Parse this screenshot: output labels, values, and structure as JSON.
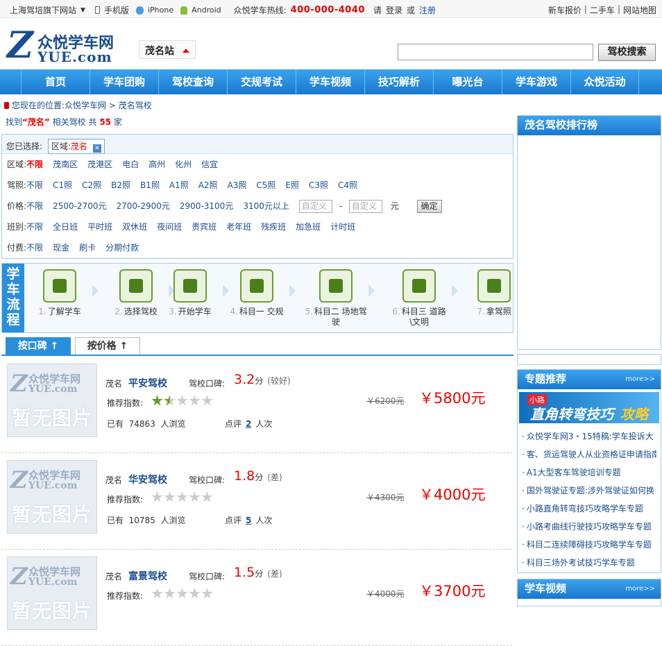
{
  "topbar": {
    "site_brand": "上海驾培旗下网站",
    "mobile": "手机版",
    "iphone": "iPhone",
    "android": "Android",
    "hotline_label": "众悦学车热线:",
    "hotline": "400-000-4040",
    "please": "请",
    "login": "登录",
    "or": "或",
    "register": "注册",
    "links": [
      "新车报价",
      "二手车",
      "网站地图"
    ],
    "sep": "|"
  },
  "header": {
    "logo_z": "Z",
    "logo_cn": "众悦学车网",
    "logo_en": "YUE.com",
    "city": "茂名站",
    "search_placeholder": "",
    "search_button": "驾校搜索"
  },
  "nav": [
    "首页",
    "学车团购",
    "驾校查询",
    "交规考试",
    "学车视频",
    "技巧解析",
    "曝光台",
    "学车游戏",
    "众悦活动"
  ],
  "breadcrumb": {
    "prefix": "您现在的位置:",
    "home": "众悦学车网",
    "arrow": ">",
    "current": "茂名驾校"
  },
  "found": {
    "pre": "找到",
    "keyword": "“茂名”",
    "mid": "相关驾校",
    "gong": "共",
    "count": "55",
    "unit": "家"
  },
  "filter": {
    "selected_label": "您已选择:",
    "selected_key": "区域:",
    "selected_val": "茂名",
    "rows": [
      {
        "label": "区域:",
        "options": [
          "不限",
          "茂南区",
          "茂港区",
          "电白",
          "高州",
          "化州",
          "信宜"
        ],
        "active": 0
      },
      {
        "label": "驾照:",
        "options": [
          "不限",
          "C1照",
          "C2照",
          "B2照",
          "B1照",
          "A1照",
          "A2照",
          "A3照",
          "C5照",
          "E照",
          "C3照",
          "C4照"
        ],
        "active": -1
      },
      {
        "label": "价格:",
        "options": [
          "不限",
          "2500-2700元",
          "2700-2900元",
          "2900-3100元",
          "3100元以上"
        ],
        "active": -1
      },
      {
        "label": "班别:",
        "options": [
          "不限",
          "全日班",
          "平时班",
          "双休班",
          "夜间班",
          "贵宾班",
          "老年班",
          "残疾班",
          "加急班",
          "计时班"
        ],
        "active": -1
      },
      {
        "label": "付费:",
        "options": [
          "不限",
          "现金",
          "刷卡",
          "分期付款"
        ],
        "active": -1
      }
    ],
    "custom1": "自定义",
    "dash": "-",
    "custom2": "自定义",
    "yuan": "元",
    "ok": "确定"
  },
  "process": {
    "title": "学车流程",
    "steps": [
      {
        "num": "1.",
        "text": "了解学车"
      },
      {
        "num": "2.",
        "text": "选择驾校"
      },
      {
        "num": "3.",
        "text": "开始学车"
      },
      {
        "num": "4.",
        "text": "科目一 交规"
      },
      {
        "num": "5.",
        "text": "科目二 场地驾驶"
      },
      {
        "num": "6.",
        "text": "科目三 道路\\文明"
      },
      {
        "num": "7.",
        "text": "拿驾照"
      }
    ]
  },
  "tabs": {
    "by_rating": "按口碑 ↑",
    "by_price": "按价格 ↑"
  },
  "schools": [
    {
      "area": "茂名",
      "name": "平安驾校",
      "kb_label": "驾校口碑:",
      "score": "3.2",
      "fen": "分",
      "level": "(较好)",
      "rec_label": "推荐指数:",
      "stars": 1.5,
      "views_pre": "已有",
      "views": "74863",
      "views_post": "人浏览",
      "cmt_pre": "点评",
      "cmt": "2",
      "cmt_post": "人次",
      "old_price": "￥6200元",
      "price": "￥5800元"
    },
    {
      "area": "茂名",
      "name": "华安驾校",
      "kb_label": "驾校口碑:",
      "score": "1.8",
      "fen": "分",
      "level": "(差)",
      "rec_label": "推荐指数:",
      "stars": 0,
      "views_pre": "已有",
      "views": "10785",
      "views_post": "人浏览",
      "cmt_pre": "点评",
      "cmt": "5",
      "cmt_post": "人次",
      "old_price": "￥4300元",
      "price": "￥4000元"
    },
    {
      "area": "茂名",
      "name": "富景驾校",
      "kb_label": "驾校口碑:",
      "score": "1.5",
      "fen": "分",
      "level": "(差)",
      "rec_label": "推荐指数:",
      "stars": 0,
      "views_pre": "",
      "views": "",
      "views_post": "",
      "cmt_pre": "",
      "cmt": "",
      "cmt_post": "",
      "old_price": "￥4000元",
      "price": "￥3700元"
    }
  ],
  "noimg": {
    "cn": "众悦学车网",
    "en": "YUE.com",
    "z": "Z",
    "na": "暂无图片"
  },
  "sidebar": {
    "rank_title": "茂名驾校排行榜",
    "topic_title": "专题推荐",
    "more": "more>>",
    "banner_small": "小路",
    "banner_main": "直角转弯技巧",
    "banner_gl": "攻略",
    "topics": [
      "众悦学车网3・15特稿:学车投诉大",
      "客、货运驾驶人从业资格证申请指南",
      "A1大型客车驾驶培训专题",
      "国外驾驶证专题:涉外驾驶证如何换",
      "小路直角转弯技巧攻略学车专题",
      "小路考曲线行驶技巧攻略学车专题",
      "科目二连续障碍技巧攻略学车专题",
      "科目三场外考试技巧学车专题"
    ],
    "video_title": "学车视频"
  },
  "colors": {
    "accent": "#1878cf",
    "price": "#e00000",
    "link": "#1a4d8f"
  }
}
